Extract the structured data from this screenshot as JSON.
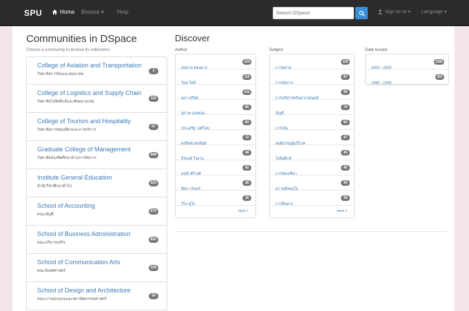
{
  "navbar": {
    "brand": "SPU",
    "home_label": "Home",
    "browse_label": "Browse ▾",
    "help_label": "Help",
    "search_placeholder": "Search DSpace",
    "signin_label": "Sign on to ▾",
    "language_label": "Language ▾"
  },
  "communities": {
    "title": "Communities in DSpace",
    "subtitle": "Choose a community to browse its collections.",
    "items": [
      {
        "name": "College of Aviation and Transportation",
        "thai": "วิทยาลัยการบินและคมนาคม",
        "count": "3"
      },
      {
        "name": "College of Logistics and Supply Chain",
        "thai": "วิทยาลัยโลจิสติกส์และซัพพลายเชน",
        "count": "110"
      },
      {
        "name": "College of Tourism and Hospitality",
        "thai": "วิทยาลัยการท่องเที่ยวและการบริการ",
        "count": "67"
      },
      {
        "name": "Graduate College of Management",
        "thai": "วิทยาลัยบัณฑิตศึกษาด้านการจัดการ",
        "count": "698"
      },
      {
        "name": "Institute General Education",
        "thai": "สำนักวิชาศึกษาทั่วไป",
        "count": "525"
      },
      {
        "name": "School of Accounting",
        "thai": "คณะบัญชี",
        "count": "670"
      },
      {
        "name": "School of Business Administration",
        "thai": "คณะบริหารธุรกิจ",
        "count": "822"
      },
      {
        "name": "School of Communication Arts",
        "thai": "คณะนิเทศศาสตร์",
        "count": "328"
      },
      {
        "name": "School of Design and Architecture",
        "thai": "คณะการออกแบบและสถาปัตยกรรมศาสตร์",
        "count": "54"
      }
    ]
  },
  "discover": {
    "title": "Discover",
    "author": {
      "label": "Author",
      "items": [
        {
          "name": "สมชาย ทองมาก",
          "count": "104"
        },
        {
          "name": "วิมล ใจดี",
          "count": "110"
        },
        {
          "name": "นภา ศรีสุข",
          "count": "102"
        },
        {
          "name": "สุภาพ แสงทอง",
          "count": "85"
        },
        {
          "name": "ประเสริฐ วงศ์ไทย",
          "count": "80"
        },
        {
          "name": "พรทิพย์ สุขสันต์",
          "count": "72"
        },
        {
          "name": "ธีรพงษ์ ใจงาม",
          "count": "48"
        },
        {
          "name": "อรุณี ศรีวงศ์",
          "count": "42"
        },
        {
          "name": "จิตรา จันทร์",
          "count": "38"
        },
        {
          "name": "วิไล ชูใจ",
          "count": "35"
        }
      ],
      "more": "next >"
    },
    "subject": {
      "label": "Subject",
      "items": [
        {
          "name": "การตลาด",
          "count": "105"
        },
        {
          "name": "การจัดการ",
          "count": "97"
        },
        {
          "name": "การบริหารทรัพยากรมนุษย์",
          "count": "95"
        },
        {
          "name": "บัญชี",
          "count": "74"
        },
        {
          "name": "การเงิน",
          "count": "60"
        },
        {
          "name": "พฤติกรรมผู้บริโภค",
          "count": "47"
        },
        {
          "name": "โลจิสติกส์",
          "count": "44"
        },
        {
          "name": "การท่องเที่ยว",
          "count": "40"
        },
        {
          "name": "ความพึงพอใจ",
          "count": "40"
        },
        {
          "name": "การสื่อสาร",
          "count": "38"
        }
      ],
      "more": "next >"
    },
    "date": {
      "label": "Date Issued",
      "items": [
        {
          "name": "2000 - 2009",
          "count": "1599"
        },
        {
          "name": "1990 - 1999",
          "count": "257"
        }
      ]
    }
  },
  "colors": {
    "navbar": "#2b2b2b",
    "link": "#3c7ab6",
    "badge": "#777777",
    "page_bg": "#f3e6ea",
    "search_button": "#3a8fd6"
  }
}
